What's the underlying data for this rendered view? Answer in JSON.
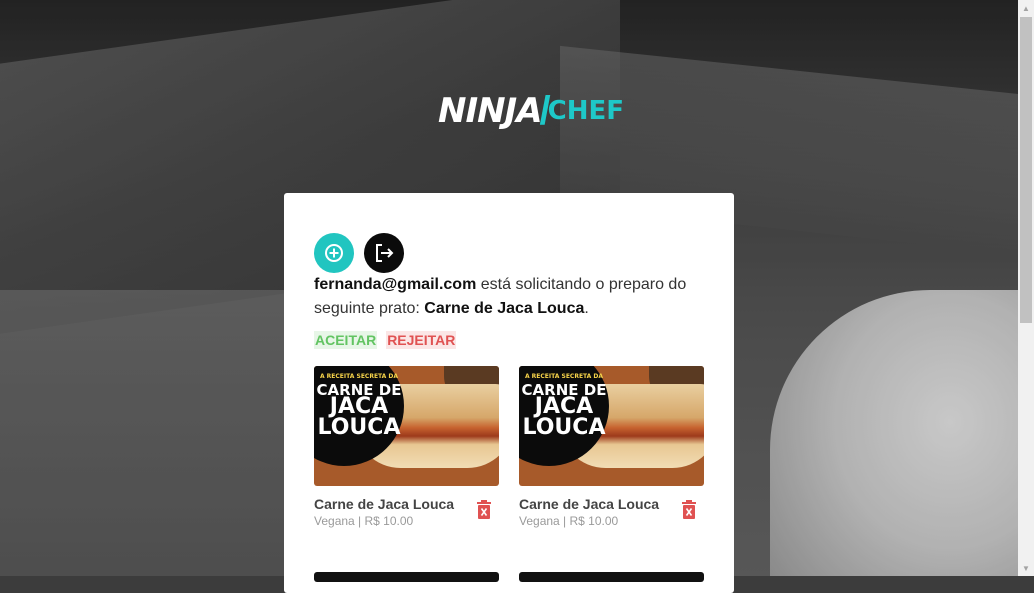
{
  "brand": {
    "name_part1": "NINJA",
    "name_part2": "CHEF",
    "accent": "#21c5c0"
  },
  "actions": {
    "add_icon": "plus-circle-icon",
    "logout_icon": "logout-icon"
  },
  "request": {
    "email": "fernanda@gmail.com",
    "text_middle": " está solicitando o preparo do seguinte prato: ",
    "dish": "Carne de Jaca Louca",
    "end": "."
  },
  "decision": {
    "accept_label": "ACEITAR",
    "reject_label": "REJEITAR"
  },
  "dishes": [
    {
      "name": "Carne de Jaca Louca",
      "meta": "Vegana | R$ 10.00",
      "badge_small": "A RECEITA SECRETA DA",
      "badge_line1": "CARNE DE",
      "badge_line2": "JACA",
      "badge_line3": "LOUCA"
    },
    {
      "name": "Carne de Jaca Louca",
      "meta": "Vegana | R$ 10.00",
      "badge_small": "A RECEITA SECRETA DA",
      "badge_line1": "CARNE DE",
      "badge_line2": "JACA",
      "badge_line3": "LOUCA"
    }
  ]
}
